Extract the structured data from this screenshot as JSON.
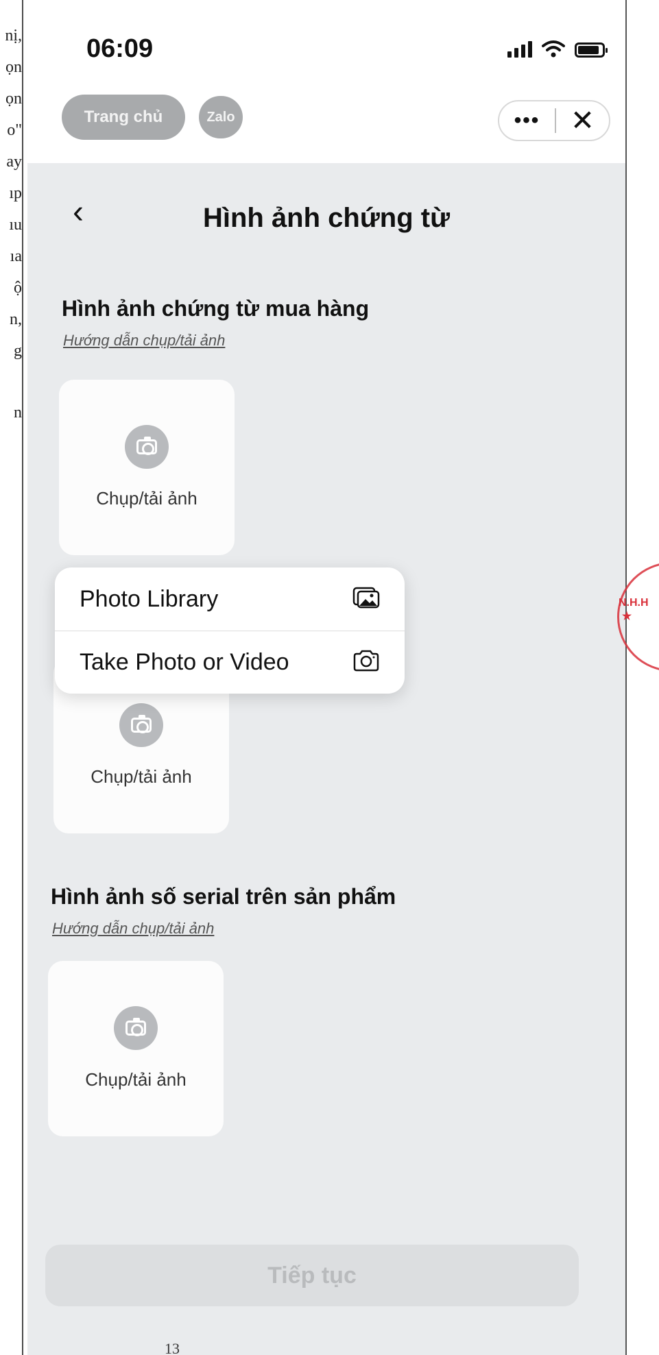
{
  "document": {
    "fragments": [
      "nị,",
      "ọn",
      "ọn",
      "o\"",
      "ay",
      "ıp",
      "ıu",
      "ıa",
      "ộ",
      "n,",
      "g",
      "n"
    ],
    "page_number": "13",
    "stamp_text": "N.H.H ★"
  },
  "status_bar": {
    "time": "06:09",
    "icons": [
      "signal-icon",
      "wifi-icon",
      "battery-icon"
    ]
  },
  "mini_app_bar": {
    "home_label": "Trang chủ",
    "brand_label": "Zalo",
    "more_label": "•••",
    "close_label": "✕"
  },
  "header": {
    "back_label": "‹",
    "title": "Hình ảnh chứng từ"
  },
  "sections": [
    {
      "title": "Hình ảnh chứng từ mua hàng",
      "guide_link": "Hướng dẫn chụp/tải ảnh",
      "uploads": [
        {
          "label": "Chụp/tải ảnh"
        },
        {
          "label": "Chụp/tải ảnh"
        }
      ]
    },
    {
      "title": "Hình ảnh số serial trên sản phẩm",
      "guide_link": "Hướng dẫn chụp/tải ảnh",
      "uploads": [
        {
          "label": "Chụp/tải ảnh"
        }
      ]
    }
  ],
  "action_menu": {
    "items": [
      {
        "label": "Photo Library",
        "icon": "photo-library-icon"
      },
      {
        "label": "Take Photo or Video",
        "icon": "camera-icon"
      }
    ]
  },
  "footer": {
    "continue_label": "Tiếp tục"
  },
  "colors": {
    "content_bg": "#e9ebed",
    "pill_gray": "#a8aaac",
    "stamp_red": "#d9303a"
  }
}
